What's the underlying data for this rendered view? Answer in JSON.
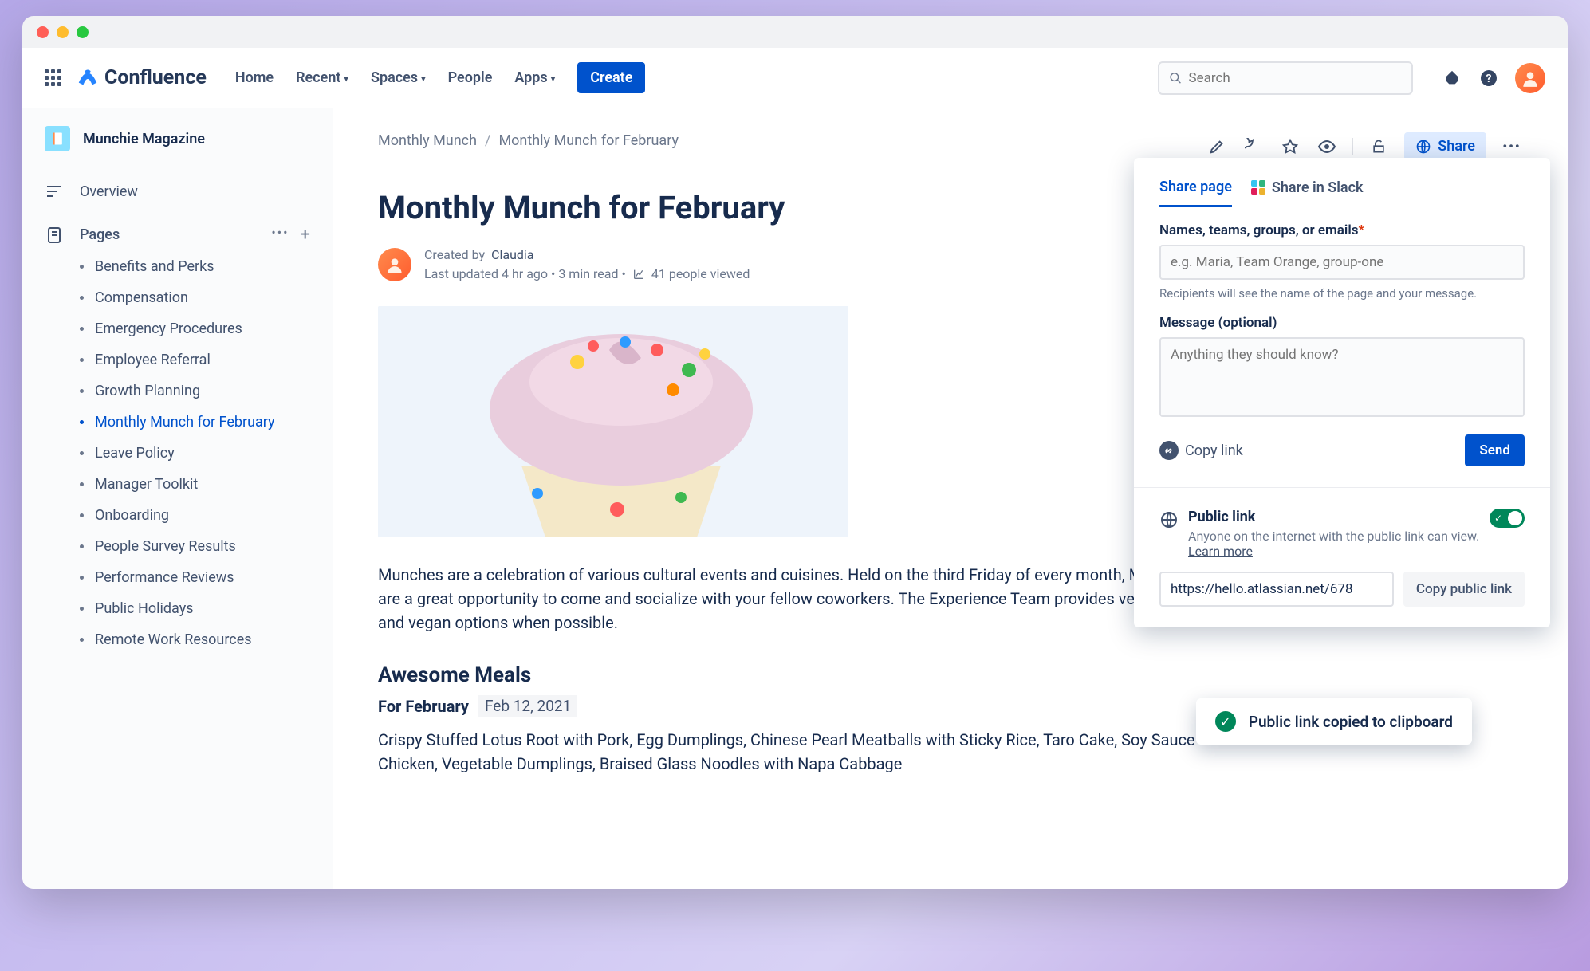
{
  "header": {
    "product": "Confluence",
    "nav": [
      "Home",
      "Recent",
      "Spaces",
      "People",
      "Apps"
    ],
    "nav_has_chevron": [
      false,
      true,
      true,
      false,
      true
    ],
    "create": "Create",
    "search_placeholder": "Search"
  },
  "sidebar": {
    "space_name": "Munchie Magazine",
    "overview": "Overview",
    "section_label": "Pages",
    "pages": [
      "Benefits and Perks",
      "Compensation",
      "Emergency Procedures",
      "Employee Referral",
      "Growth Planning",
      "Monthly Munch for February",
      "Leave Policy",
      "Manager Toolkit",
      "Onboarding",
      "People Survey Results",
      "Performance Reviews",
      "Public Holidays",
      "Remote Work Resources"
    ],
    "active_index": 5
  },
  "breadcrumb": [
    "Monthly Munch",
    "Monthly Munch for February"
  ],
  "page": {
    "title": "Monthly Munch for February",
    "author": "Claudia",
    "created_prefix": "Created by ",
    "meta": "Last updated 4 hr ago  •  3 min read  •",
    "views": "41 people viewed",
    "paragraph": "Munches are a celebration of various cultural events and cuisines. Held on the third Friday of every month, Munches are a great opportunity to come and socialize with your fellow coworkers. The Experience Team provides vegetarian and vegan options when possible.",
    "h2": "Awesome Meals",
    "h3": "For February",
    "date": "Feb 12, 2021",
    "menu": "Crispy Stuffed Lotus Root with Pork, Egg Dumplings, Chinese Pearl Meatballs with Sticky Rice, Taro Cake, Soy Sauce Chicken, Vegetable Dumplings, Braised Glass Noodles with Napa Cabbage"
  },
  "actions": {
    "share": "Share"
  },
  "popover": {
    "tab_share": "Share page",
    "tab_slack": "Share in Slack",
    "names_label": "Names, teams, groups, or emails",
    "names_placeholder": "e.g. Maria, Team Orange, group-one",
    "names_hint": "Recipients will see the name of the page and your message.",
    "message_label": "Message (optional)",
    "message_placeholder": "Anything they should know?",
    "copy_link": "Copy link",
    "send": "Send",
    "public_title": "Public link",
    "public_desc": "Anyone on the internet with the public link can view. ",
    "learn_more": "Learn more",
    "public_url": "https://hello.atlassian.net/678",
    "copy_public": "Copy public link"
  },
  "toast": "Public link copied to clipboard"
}
